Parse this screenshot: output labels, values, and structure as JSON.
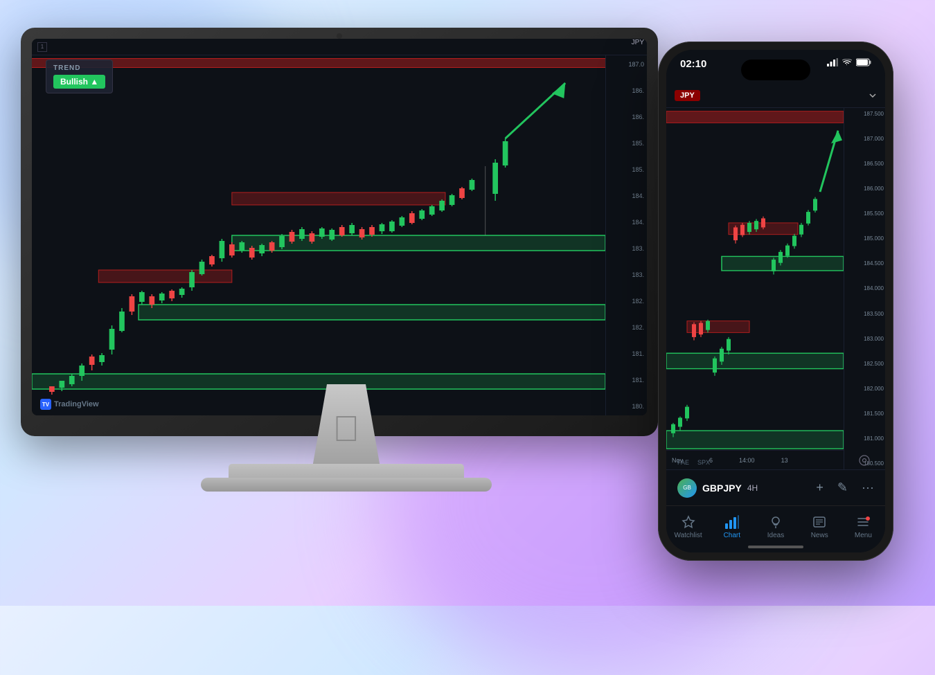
{
  "background": {
    "blob_colors": [
      "#a0c4ff",
      "#c084fc",
      "#67e8f9"
    ]
  },
  "imac": {
    "screen_label": "iMac Screen",
    "trend_label": "TREND",
    "bullish_text": "Bullish ▲",
    "tradingview_label": "TradingView",
    "price_ticks": [
      "187.0",
      "186.",
      "185.",
      "185.",
      "184.",
      "184.",
      "183.",
      "183.",
      "182.",
      "182.",
      "181.",
      "181.",
      "180."
    ],
    "currency_label": "JPY"
  },
  "phone": {
    "time": "02:10",
    "currency_label": "JPY",
    "symbol": "GBPJPY",
    "timeframe": "4H",
    "price_ticks": [
      "187.500",
      "187.000",
      "186.500",
      "186.000",
      "185.500",
      "185.000",
      "184.500",
      "184.000",
      "183.500",
      "183.000",
      "182.500",
      "182.000",
      "181.500",
      "181.000",
      "180.500"
    ],
    "xaxis_labels": [
      "Nov",
      "6",
      "14:00",
      "13"
    ],
    "fae_label": "FAE",
    "spy_label": "SPX",
    "nav_items": [
      {
        "label": "Watchlist",
        "icon": "star",
        "active": false
      },
      {
        "label": "Chart",
        "icon": "chart",
        "active": true
      },
      {
        "label": "Ideas",
        "icon": "lightbulb",
        "active": false
      },
      {
        "label": "News",
        "icon": "news",
        "active": false
      },
      {
        "label": "Menu",
        "icon": "menu",
        "active": false
      }
    ],
    "add_button": "+",
    "pen_button": "✎",
    "more_button": "···"
  }
}
